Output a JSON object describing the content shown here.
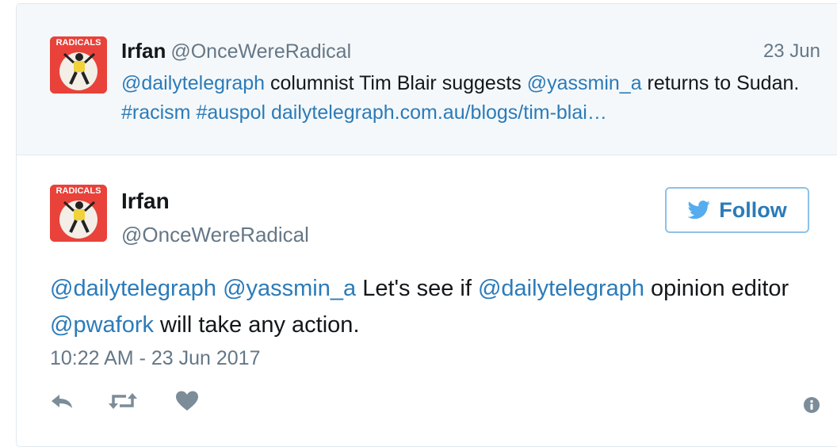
{
  "parent_tweet": {
    "author_name": "Irfan",
    "author_handle": "@OnceWereRadical",
    "date": "23 Jun",
    "avatar_text": "RADICALS",
    "text": {
      "mention1": "@dailytelegraph",
      "plain1": " columnist Tim Blair suggests ",
      "mention2": "@yassmin_a",
      "plain2": " returns to Sudan. ",
      "hashtag1": "#racism",
      "plain3": " ",
      "hashtag2": "#auspol",
      "plain4": " ",
      "link": "dailytelegraph.com.au/blogs/tim-blai…"
    }
  },
  "main_tweet": {
    "author_name": "Irfan",
    "author_handle": "@OnceWereRadical",
    "avatar_text": "RADICALS",
    "follow_label": "Follow",
    "text": {
      "mention1": "@dailytelegraph",
      "plain1": " ",
      "mention2": "@yassmin_a",
      "plain2": " Let's see if ",
      "mention3": "@dailytelegraph",
      "plain3": " opinion editor ",
      "mention4": "@pwafork",
      "plain4": " will take any action."
    },
    "timestamp": "10:22 AM - 23 Jun 2017"
  },
  "icons": {
    "reply": "reply-icon",
    "retweet": "retweet-icon",
    "like": "heart-icon",
    "info": "info-icon",
    "follow": "twitter-bird-icon"
  },
  "colors": {
    "link": "#2b7bb9",
    "muted": "#657786",
    "avatar_bg": "#e8423a",
    "parent_bg": "#f5f8fa",
    "follow_border": "#8ec1e8",
    "action_gray": "#7c8c98"
  }
}
